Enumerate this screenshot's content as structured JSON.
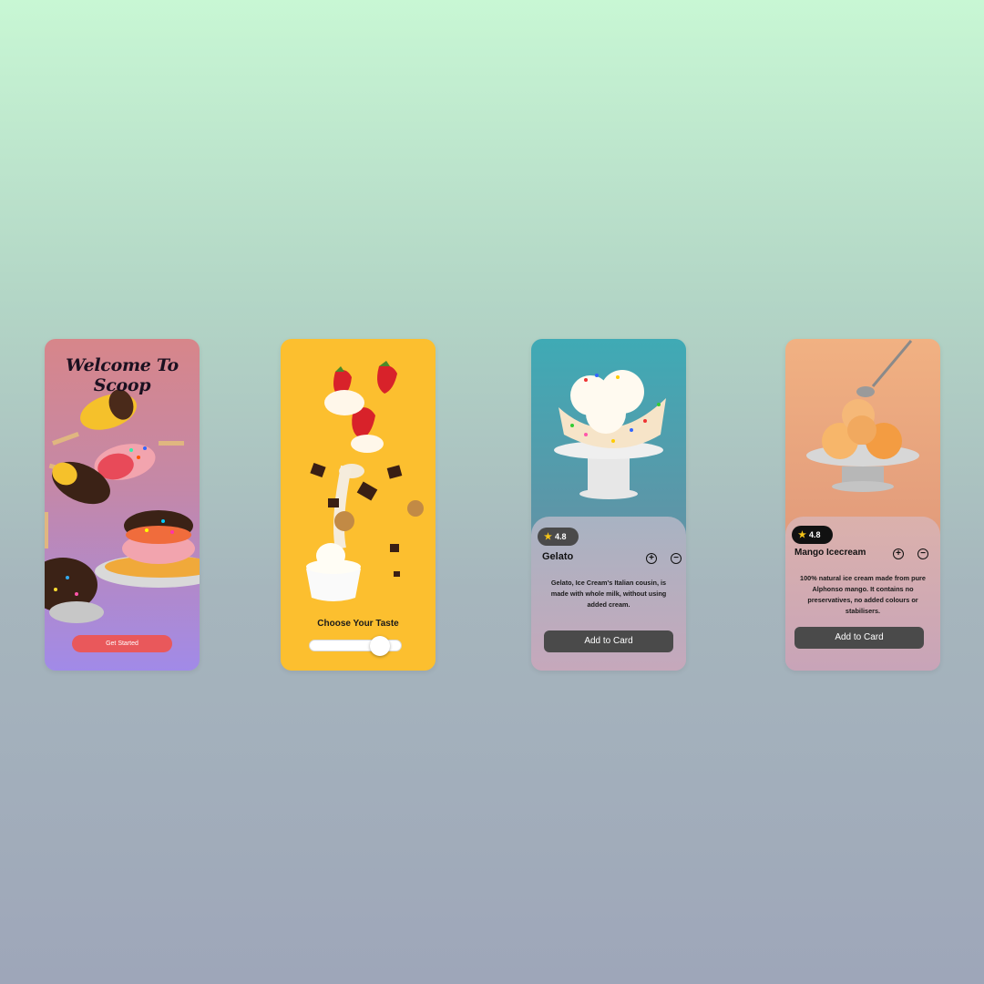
{
  "screens": {
    "welcome": {
      "title": "Welcome To Scoop",
      "cta_label": "Get Started"
    },
    "taste": {
      "title": "Choose Your Taste",
      "slider_value": 0.85
    },
    "gelato": {
      "rating": "4.8",
      "name": "Gelato",
      "plus_icon": "+",
      "minus_icon": "−",
      "description": "Gelato, Ice Cream's Italian cousin, is made with whole milk, without using added cream.",
      "cta_label": "Add  to Card"
    },
    "mango": {
      "rating": "4.8",
      "name": "Mango Icecream",
      "plus_icon": "+",
      "minus_icon": "−",
      "description": "100% natural ice cream made from pure Alphonso mango. It contains no preservatives, no added colours or stabilisers.",
      "cta_label": "Add  to Card"
    }
  },
  "colors": {
    "background_top": "#c8f7d4",
    "background_bottom": "#9ea6b9",
    "cta_red": "#e9585b",
    "taste_yellow": "#fcbf2f",
    "dark_button": "#4a4a4a",
    "star": "#f5c518"
  }
}
